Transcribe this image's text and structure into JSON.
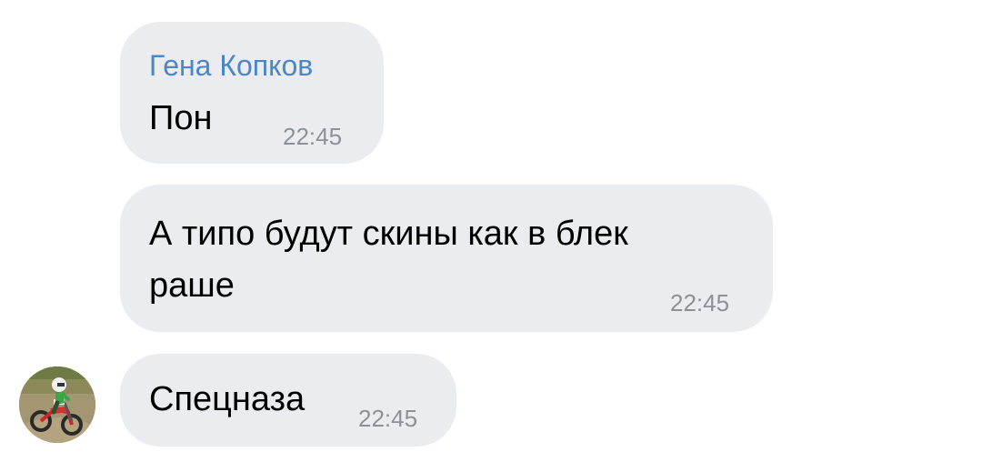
{
  "messages": [
    {
      "sender": "Гена Копков",
      "text": "Пон",
      "time": "22:45"
    },
    {
      "text_line1": "А типо будут скины как в блек",
      "text_line2": "раше",
      "time": "22:45"
    },
    {
      "text": "Спецназа",
      "time": "22:45",
      "avatar": "motocross-rider-avatar"
    }
  ],
  "colors": {
    "bubble": "#ebecf0",
    "sender_name": "#4a86c8",
    "timestamp": "#8c9198",
    "background": "#ffffff"
  }
}
